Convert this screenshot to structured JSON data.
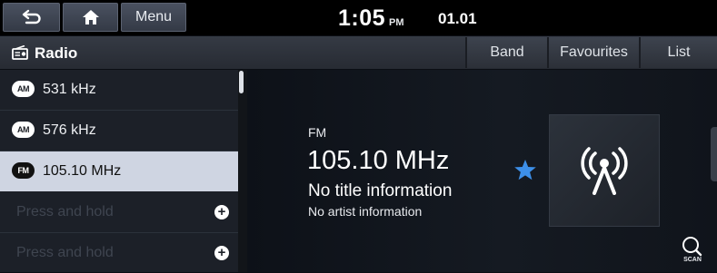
{
  "topbar": {
    "back_icon": "back-arrow-icon",
    "home_icon": "home-icon",
    "menu_label": "Menu",
    "time": "1:05",
    "ampm": "PM",
    "date": "01.01"
  },
  "header": {
    "title": "Radio",
    "title_icon": "radio-icon",
    "buttons": [
      "Band",
      "Favourites",
      "List"
    ]
  },
  "stations": [
    {
      "band": "AM",
      "label": "531 kHz"
    },
    {
      "band": "AM",
      "label": "576 kHz"
    },
    {
      "band": "FM",
      "label": "105.10 MHz",
      "selected": true
    },
    {
      "label": "Press and hold",
      "empty": true
    },
    {
      "label": "Press and hold",
      "empty": true
    }
  ],
  "now_playing": {
    "band": "FM",
    "frequency": "105.10 MHz",
    "title": "No title information",
    "artist": "No artist information",
    "favourite": true,
    "art_icon": "antenna-signal-icon"
  },
  "scan": {
    "label": "SCAN",
    "icon": "scan-search-icon"
  },
  "colors": {
    "accent": "#3d8fe8",
    "selected_row": "#cfd5e2",
    "topbar": "#000000"
  }
}
